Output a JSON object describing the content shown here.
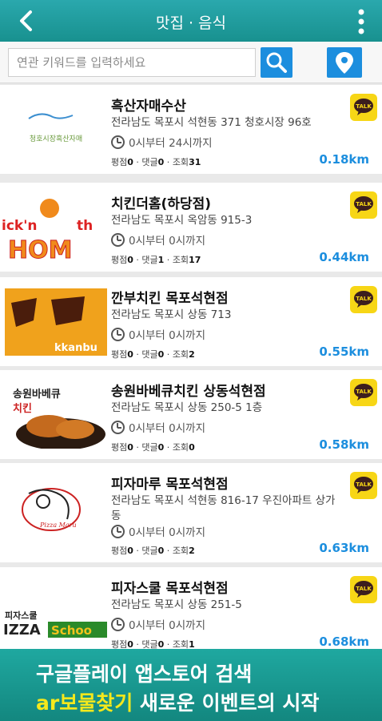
{
  "header": {
    "title": "맛집 · 음식"
  },
  "search": {
    "placeholder": "연관 키워드를 입력하세요"
  },
  "labels": {
    "rating": "평점",
    "comments": "댓글",
    "views": "조회",
    "talk": "TALK"
  },
  "restaurants": [
    {
      "name": "흑산자매수산",
      "address": "전라남도 목포시 석현동 371 청호시장 96호",
      "hours": "0시부터 24시까지",
      "rating": "0",
      "comments": "0",
      "views": "31",
      "distance": "0.18km",
      "thumb_text": "청호시장흑산자매"
    },
    {
      "name": "치킨더홈(하당점)",
      "address": "전라남도 목포시 옥암동 915-3",
      "hours": "0시부터 0시까지",
      "rating": "0",
      "comments": "1",
      "views": "17",
      "distance": "0.44km",
      "thumb_text": "ick'n th HOM"
    },
    {
      "name": "깐부치킨 목포석현점",
      "address": "전라남도 목포시 상동 713",
      "hours": "0시부터 0시까지",
      "rating": "0",
      "comments": "0",
      "views": "2",
      "distance": "0.55km",
      "thumb_text": "kkanbu"
    },
    {
      "name": "송원바베큐치킨 상동석현점",
      "address": "전라남도 목포시 상동 250-5 1층",
      "hours": "0시부터 0시까지",
      "rating": "0",
      "comments": "0",
      "views": "0",
      "distance": "0.58km",
      "thumb_text": "송원바베큐 치킨"
    },
    {
      "name": "피자마루 목포석현점",
      "address": "전라남도 목포시 석현동 816-17 우진아파트 상가동",
      "hours": "0시부터 0시까지",
      "rating": "0",
      "comments": "0",
      "views": "2",
      "distance": "0.63km",
      "thumb_text": "Pizza Maru"
    },
    {
      "name": "피자스쿨 목포석현점",
      "address": "전라남도 목포시 상동 251-5",
      "hours": "0시부터 0시까지",
      "rating": "0",
      "comments": "0",
      "views": "1",
      "distance": "0.68km",
      "thumb_text": "피자스쿨 IZZA Schoo"
    }
  ],
  "banner": {
    "line1": "구글플레이 앱스토어 검색",
    "line2_highlight": "ar보물찾기",
    "line2_rest": " 새로운 이벤트의 시작"
  },
  "colors": {
    "accent": "#1c8ede",
    "header": "#1fa3a3",
    "talk": "#f7d616"
  }
}
